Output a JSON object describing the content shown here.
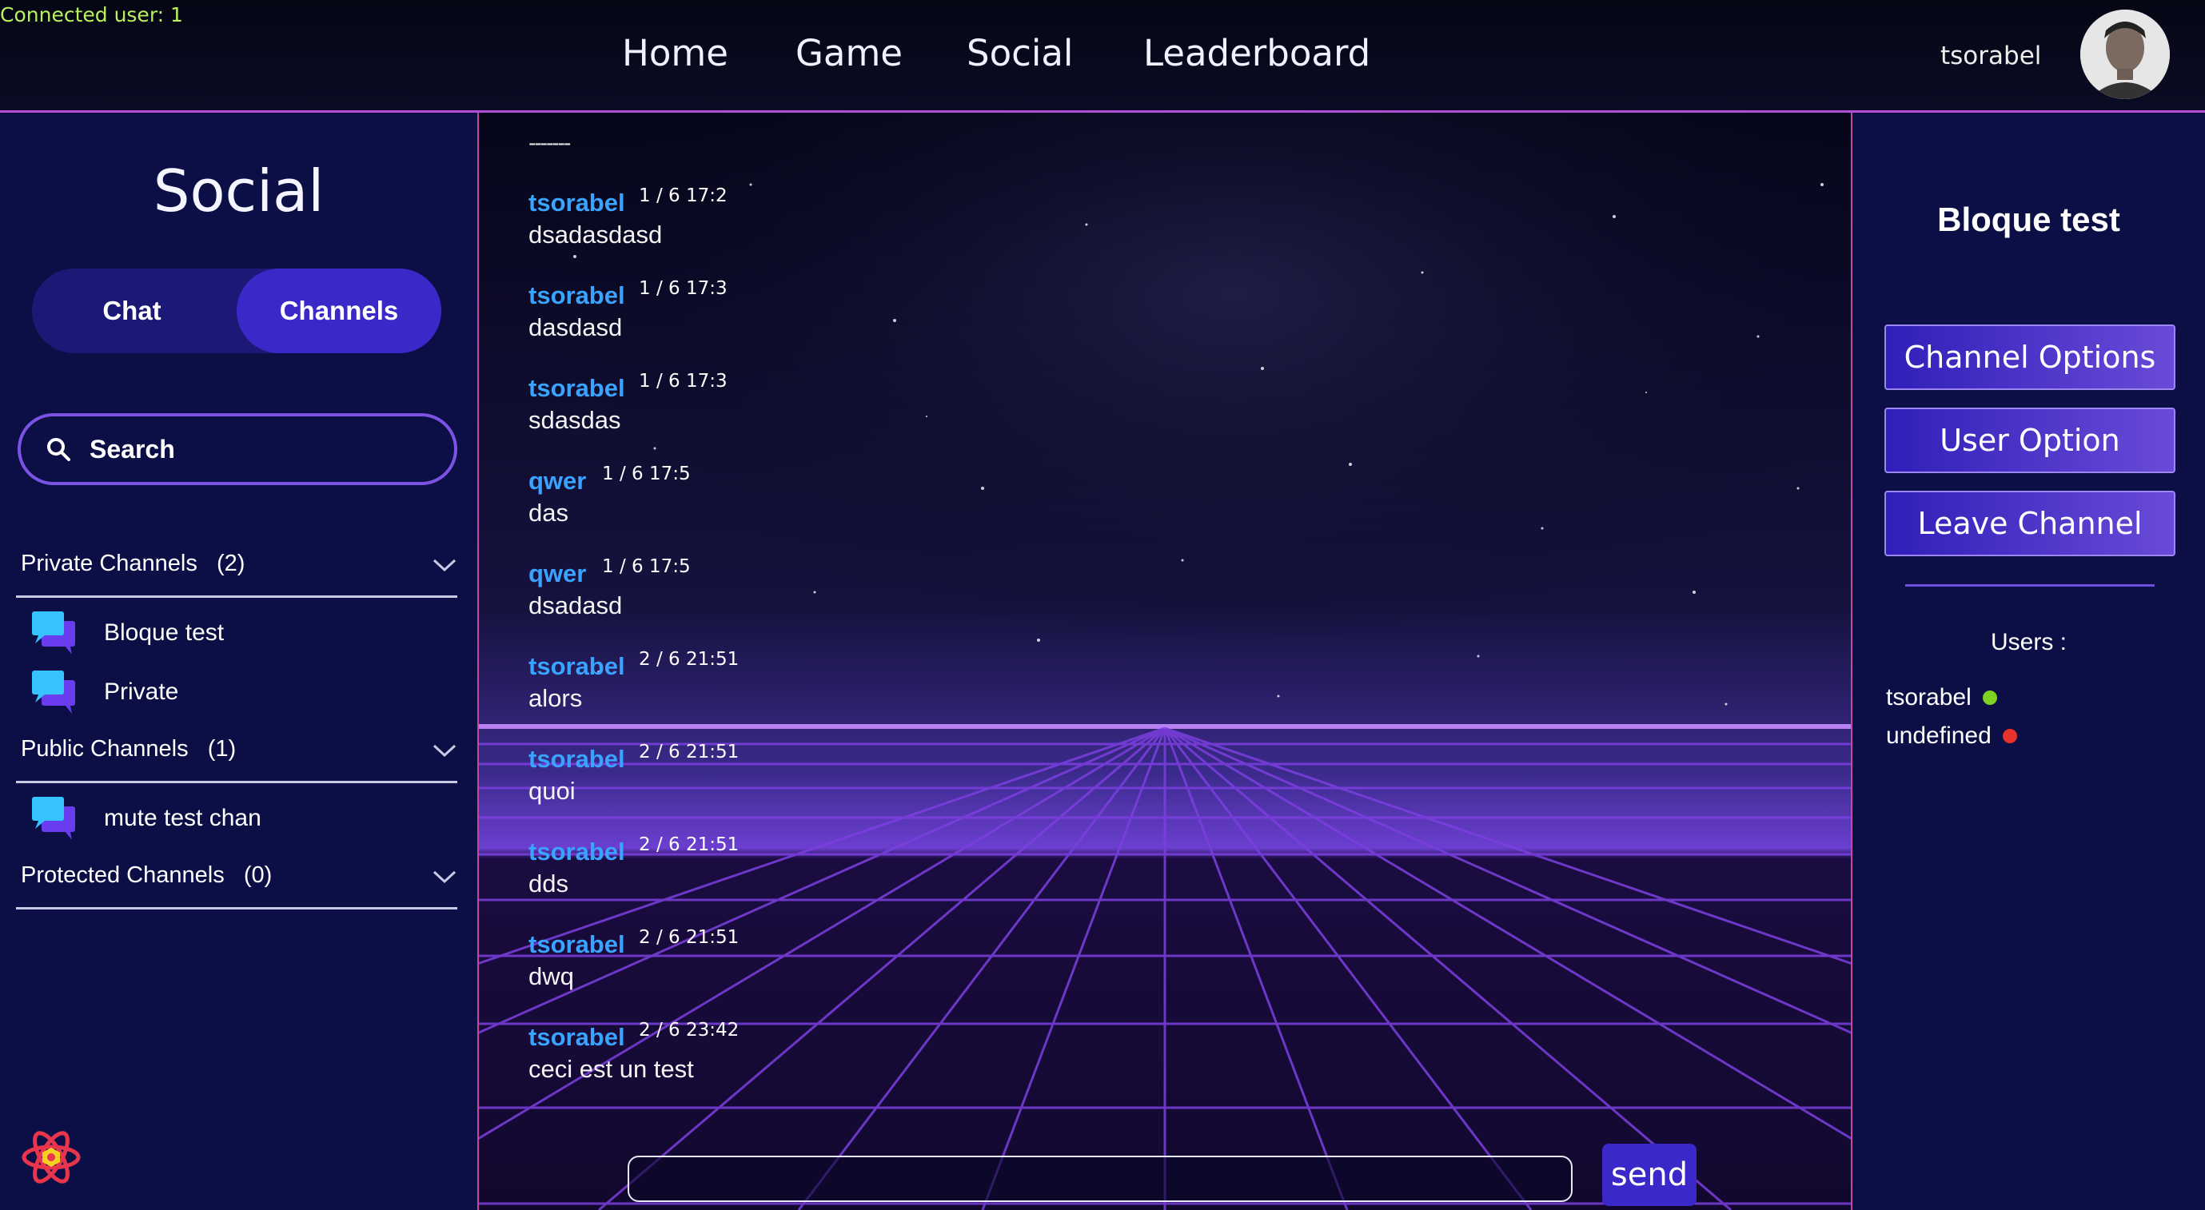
{
  "status": {
    "connected": "Connected user: 1"
  },
  "nav": {
    "items": [
      "Home",
      "Game",
      "Social",
      "Leaderboard"
    ],
    "username": "tsorabel"
  },
  "sidebar": {
    "title": "Social",
    "toggle": {
      "chat": "Chat",
      "channels": "Channels",
      "active": "channels"
    },
    "search_placeholder": "Search",
    "categories": [
      {
        "label": "Private Channels",
        "count": "(2)",
        "channels": [
          "Bloque test",
          "Private"
        ]
      },
      {
        "label": "Public Channels",
        "count": "(1)",
        "channels": [
          "mute test chan"
        ]
      },
      {
        "label": "Protected Channels",
        "count": "(0)",
        "channels": []
      }
    ]
  },
  "chat": {
    "truncated_top": "-------",
    "messages": [
      {
        "author": "tsorabel",
        "time": "1 / 6 17:2",
        "text": "dsadasdasd"
      },
      {
        "author": "tsorabel",
        "time": "1 / 6 17:3",
        "text": "dasdasd"
      },
      {
        "author": "tsorabel",
        "time": "1 / 6 17:3",
        "text": "sdasdas"
      },
      {
        "author": "qwer",
        "time": "1 / 6 17:5",
        "text": "das"
      },
      {
        "author": "qwer",
        "time": "1 / 6 17:5",
        "text": "dsadasd"
      },
      {
        "author": "tsorabel",
        "time": "2 / 6 21:51",
        "text": "alors"
      },
      {
        "author": "tsorabel",
        "time": "2 / 6 21:51",
        "text": "quoi"
      },
      {
        "author": "tsorabel",
        "time": "2 / 6 21:51",
        "text": "dds"
      },
      {
        "author": "tsorabel",
        "time": "2 / 6 21:51",
        "text": "dwq"
      },
      {
        "author": "tsorabel",
        "time": "2 / 6 23:42",
        "text": "ceci est un test"
      }
    ],
    "input_value": "",
    "send_label": "send"
  },
  "channel_panel": {
    "title": "Bloque test",
    "buttons": [
      "Channel Options",
      "User Option",
      "Leave Channel"
    ],
    "users_label": "Users :",
    "users": [
      {
        "name": "tsorabel",
        "status": "online",
        "color": "#7ed321"
      },
      {
        "name": "undefined",
        "status": "offline",
        "color": "#e8322b"
      }
    ]
  },
  "colors": {
    "accent": "#3a28c8",
    "author": "#3aa2ff",
    "border": "#c24a9a",
    "panel": "#0c0f45"
  }
}
